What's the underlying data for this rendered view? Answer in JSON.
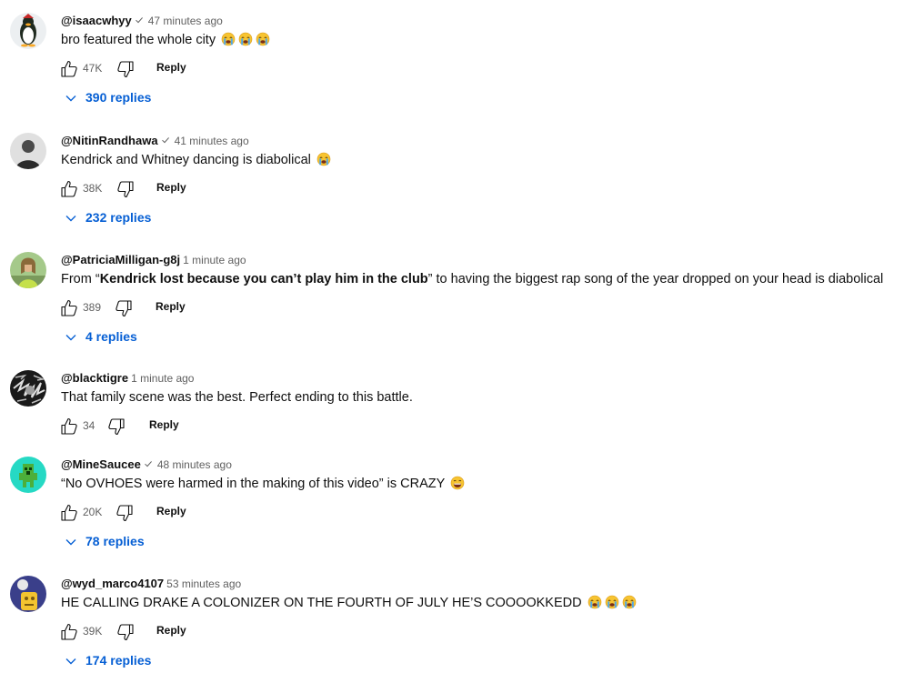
{
  "comments": [
    {
      "author": "@isaacwhyy",
      "verified": true,
      "time": "47 minutes ago",
      "text_parts": [
        "bro featured the whole city"
      ],
      "emoji_count": 3,
      "likes": "47K",
      "reply_label": "Reply",
      "replies": "390 replies"
    },
    {
      "author": "@NitinRandhawa",
      "verified": true,
      "time": "41 minutes ago",
      "text_parts": [
        "Kendrick and Whitney dancing is diabolical"
      ],
      "emoji_count": 1,
      "likes": "38K",
      "reply_label": "Reply",
      "replies": "232 replies"
    },
    {
      "author": "@PatriciaMilligan-g8j",
      "verified": false,
      "time": "1 minute ago",
      "text_parts": [
        "From “",
        "Kendrick lost because you can’t play him in the club",
        "” to having the biggest rap song of the year dropped on your head is diabolical"
      ],
      "emoji_count": 0,
      "likes": "389",
      "reply_label": "Reply",
      "replies": "4 replies"
    },
    {
      "author": "@blacktigre",
      "verified": false,
      "time": "1 minute ago",
      "text_parts": [
        "That family scene was the best. Perfect ending to this battle."
      ],
      "emoji_count": 0,
      "likes": "34",
      "reply_label": "Reply",
      "replies": ""
    },
    {
      "author": "@MineSaucee",
      "verified": true,
      "time": "48 minutes ago",
      "text_parts": [
        "“No OVHOES were harmed in the making of this video” is CRAZY"
      ],
      "emoji_count": 1,
      "likes": "20K",
      "reply_label": "Reply",
      "replies": "78 replies"
    },
    {
      "author": "@wyd_marco4107",
      "verified": false,
      "time": "53 minutes ago",
      "text_parts": [
        "HE CALLING DRAKE A COLONIZER ON THE FOURTH OF JULY HE’S COOOOKKEDD"
      ],
      "emoji_count": 3,
      "likes": "39K",
      "reply_label": "Reply",
      "replies": "174 replies"
    }
  ],
  "colors": {
    "link": "#065fd4",
    "meta": "#606060",
    "text": "#0f0f0f"
  }
}
